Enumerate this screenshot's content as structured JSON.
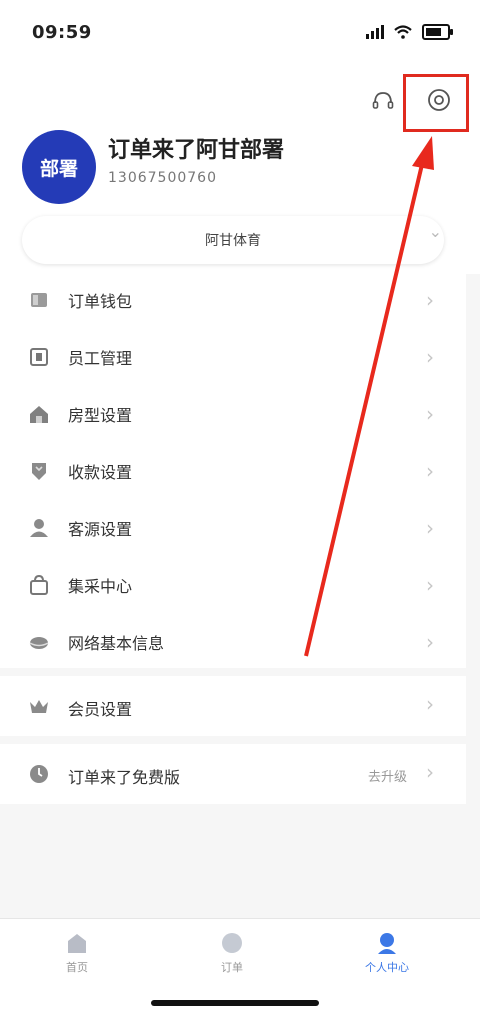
{
  "status_bar": {
    "time": "09:59"
  },
  "header": {
    "avatar_text": "部署",
    "name": "订单来了阿甘部署",
    "phone": "13067500760",
    "store_selector": "阿甘体育"
  },
  "menu": [
    {
      "label": "订单钱包",
      "icon": "wallet-icon"
    },
    {
      "label": "员工管理",
      "icon": "staff-icon"
    },
    {
      "label": "房型设置",
      "icon": "house-icon"
    },
    {
      "label": "收款设置",
      "icon": "payment-icon"
    },
    {
      "label": "客源设置",
      "icon": "customer-icon"
    },
    {
      "label": "集采中心",
      "icon": "shopping-bag-icon"
    },
    {
      "label": "网络基本信息",
      "icon": "network-icon"
    }
  ],
  "member": {
    "label": "会员设置",
    "icon": "crown-icon"
  },
  "version": {
    "label": "订单来了免费版",
    "value": "去升级",
    "icon": "clock-icon"
  },
  "tabs": [
    {
      "label": "首页",
      "icon": "home-icon",
      "active": false
    },
    {
      "label": "订单",
      "icon": "circle-icon",
      "active": false
    },
    {
      "label": "个人中心",
      "icon": "user-icon",
      "active": true
    }
  ],
  "colors": {
    "accent": "#243bb7",
    "highlight": "#e02a1f",
    "active_tab": "#3c78e6"
  }
}
